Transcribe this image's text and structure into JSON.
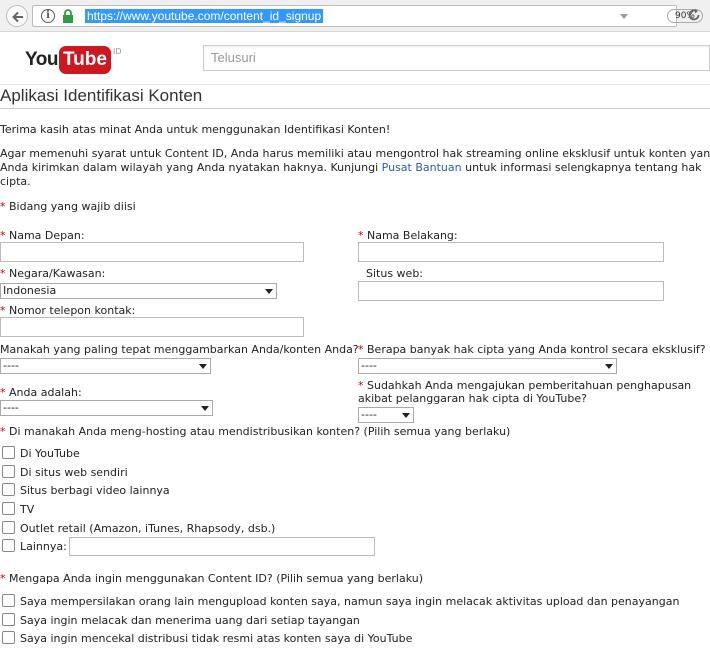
{
  "browser": {
    "url": "https://www.youtube.com/content_id_signup",
    "zoom": "90%"
  },
  "header": {
    "logo_you": "You",
    "logo_tube": "Tube",
    "logo_suffix": "ID",
    "search_placeholder": "Telusuri"
  },
  "page": {
    "title": "Aplikasi Identifikasi Konten",
    "intro": "Terima kasih atas minat Anda untuk menggunakan Identifikasi Konten!",
    "desc_1": "Agar memenuhi syarat untuk Content ID, Anda harus memiliki atau mengontrol hak streaming online eksklusif untuk konten yang",
    "desc_2_pre": "Anda kirimkan dalam wilayah yang Anda nyatakan haknya. Kunjungi ",
    "desc_2_link": "Pusat Bantuan",
    "desc_2_post": " untuk informasi selengkapnya tentang hak",
    "desc_3": "cipta.",
    "required_note": "Bidang yang wajib diisi",
    "asterisk": "*"
  },
  "form": {
    "first_name_label": "Nama Depan:",
    "last_name_label": "Nama Belakang:",
    "country_label": "Negara/Kawasan:",
    "country_value": "Indonesia",
    "website_label": "Situs web:",
    "phone_label": "Nomor telepon kontak:",
    "describe_label": "Manakah yang paling tepat menggambarkan Anda/konten Anda?",
    "describe_value": "----",
    "copyright_count_label": "Berapa banyak hak cipta yang Anda kontrol secara eksklusif?",
    "copyright_count_value": "----",
    "you_are_label": "Anda adalah:",
    "you_are_value": "----",
    "takedown_label_1": "Sudahkah Anda mengajukan pemberitahuan penghapusan",
    "takedown_label_2": "akibat pelanggaran hak cipta di YouTube?",
    "takedown_value": "----",
    "hosting_label": "Di manakah Anda meng-hosting atau mendistribusikan konten? (Pilih semua yang berlaku)",
    "hosting_options": [
      "Di YouTube",
      "Di situs web sendiri",
      "Situs berbagi video lainnya",
      "TV",
      "Outlet retail (Amazon, iTunes, Rhapsody, dsb.)",
      "Lainnya:"
    ],
    "why_label": "Mengapa Anda ingin menggunakan Content ID? (Pilih semua yang berlaku)",
    "why_options": [
      "Saya mempersilakan orang lain mengupload konten saya, namun saya ingin melacak aktivitas upload dan penayangan",
      "Saya ingin melacak dan menerima uang dari setiap tayangan",
      "Saya ingin mencekal distribusi tidak resmi atas konten saya di YouTube"
    ]
  },
  "colors": {
    "accent_red": "#cc181e",
    "required_red": "#cc0000",
    "link_blue": "#2a5db0",
    "url_highlight": "#3399ff"
  }
}
